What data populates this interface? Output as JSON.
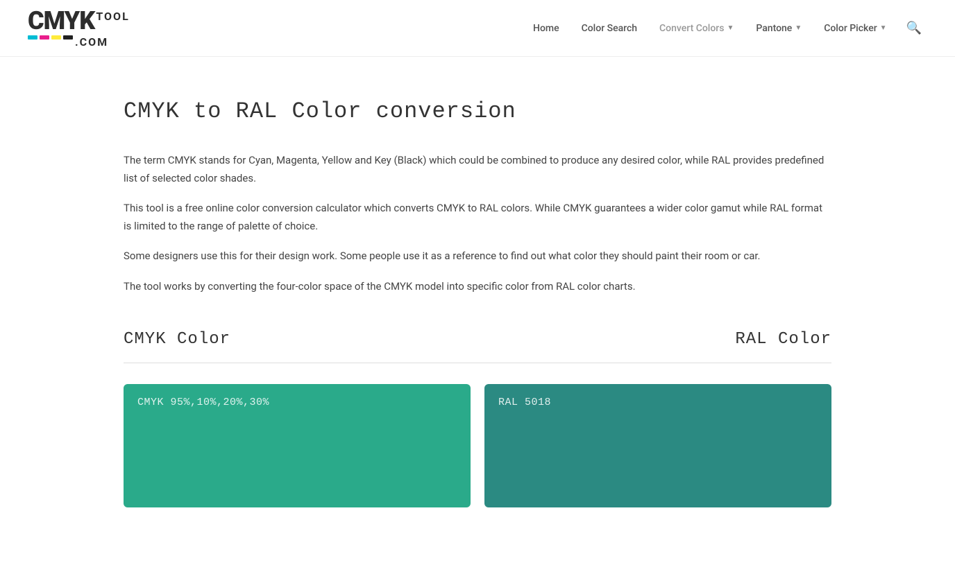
{
  "header": {
    "logo": {
      "cmyk": "CMYK",
      "tool": "TOOL",
      "com": ".COM"
    },
    "nav": {
      "home": "Home",
      "colorSearch": "Color Search",
      "convertColors": "Convert Colors",
      "pantone": "Pantone",
      "colorPicker": "Color Picker"
    }
  },
  "page": {
    "title": "CMYK to RAL Color conversion",
    "description1": "The term CMYK stands for Cyan, Magenta, Yellow and Key (Black) which could be combined to produce any desired color, while RAL provides predefined list of selected color shades.",
    "description2": "This tool is a free online color conversion calculator which converts CMYK to RAL colors. While CMYK guarantees a wider color gamut while RAL format is limited to the range of palette of choice.",
    "description3": "Some designers use this for their design work. Some people use it as a reference to find out what color they should paint their room or car.",
    "description4": "The tool works by converting the four-color space of the CMYK model into specific color from RAL color charts.",
    "cmykLabel": "CMYK Color",
    "ralLabel": "RAL Color",
    "cmykValue": "CMYK 95%,10%,20%,30%",
    "ralValue": "RAL 5018",
    "cmykColor": "#2aaa8a",
    "ralColor": "#2b8a82"
  }
}
